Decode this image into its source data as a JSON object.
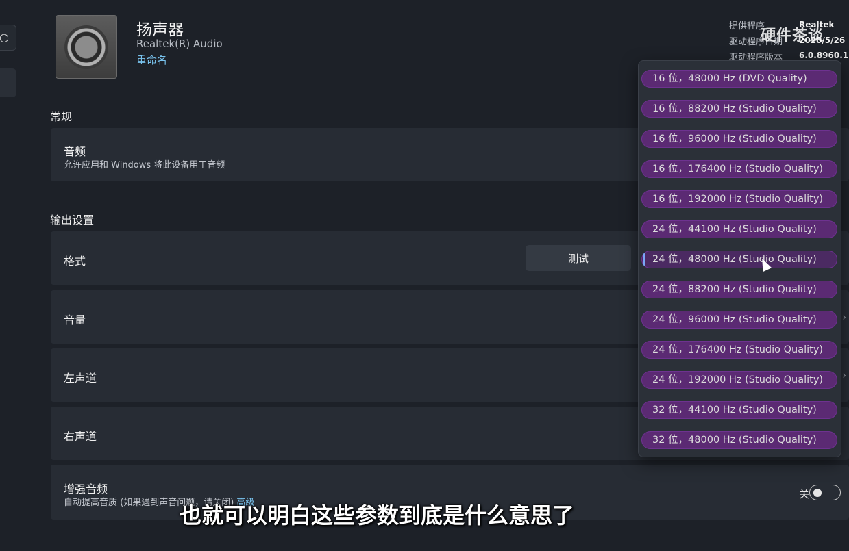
{
  "device": {
    "title": "扬声器",
    "subtitle": "Realtek(R) Audio",
    "rename_link": "重命名"
  },
  "meta": {
    "provider_label": "提供程序",
    "provider_value": "Realtek",
    "date_label": "驱动程序日期",
    "date_value": "2020/5/26",
    "version_label": "驱动程序版本",
    "version_value": "6.0.8960.1"
  },
  "watermark": "硬件茶谈",
  "sections": {
    "general": "常规",
    "output": "输出设置"
  },
  "audio_card": {
    "label": "音频",
    "desc": "允许应用和 Windows 将此设备用于音频"
  },
  "format_card": {
    "label": "格式",
    "test_button": "测试"
  },
  "volume_card": {
    "label": "音量"
  },
  "left_card": {
    "label": "左声道"
  },
  "right_card": {
    "label": "右声道"
  },
  "enhance_card": {
    "label": "增强音频",
    "desc": "自动提高音质 (如果遇到声音问题，请关闭)",
    "link": "高级",
    "toggle_label": "关",
    "toggle_on": false
  },
  "format_options": [
    "16 位，48000 Hz (DVD Quality)",
    "16 位，88200 Hz (Studio Quality)",
    "16 位，96000 Hz (Studio Quality)",
    "16 位，176400 Hz (Studio Quality)",
    "16 位，192000 Hz (Studio Quality)",
    "24 位，44100 Hz (Studio Quality)",
    "24 位，48000 Hz (Studio Quality)",
    "24 位，88200 Hz (Studio Quality)",
    "24 位，96000 Hz (Studio Quality)",
    "24 位，176400 Hz (Studio Quality)",
    "24 位，192000 Hz (Studio Quality)",
    "32 位，44100 Hz (Studio Quality)",
    "32 位，48000 Hz (Studio Quality)"
  ],
  "selected_option": "24 位，48000 Hz (Studio Quality)",
  "caption": "也就可以明白这些参数到底是什么意思了",
  "colors": {
    "background": "#1d2128",
    "card": "#272c34",
    "accent_link": "#79c3ee",
    "highlight": "#5b2a73",
    "selection_bar": "#7aa7f5"
  }
}
